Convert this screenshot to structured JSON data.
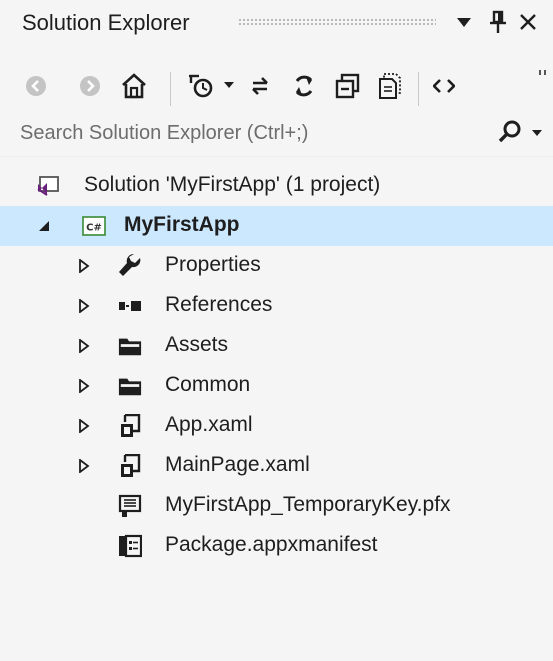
{
  "title_bar": {
    "title": "Solution Explorer",
    "icons": [
      "dropdown-arrow-icon",
      "pin-icon",
      "close-icon"
    ]
  },
  "toolbar": {
    "icons": [
      "back-icon",
      "forward-icon",
      "home-icon",
      "pending-changes-icon",
      "dropdown-arrow-icon",
      "sync-icon",
      "refresh-icon",
      "collapse-all-icon",
      "show-all-files-icon",
      "view-code-icon",
      "more-icon"
    ]
  },
  "search": {
    "placeholder": "Search Solution Explorer (Ctrl+;)",
    "icons": [
      "search-icon",
      "dropdown-arrow-icon"
    ]
  },
  "tree": {
    "solution": {
      "label": "Solution 'MyFirstApp' (1 project)",
      "icon": "solution-icon"
    },
    "project": {
      "label": "MyFirstApp",
      "icon": "csharp-project-icon",
      "expanded": true,
      "selected": true
    },
    "items": [
      {
        "label": "Properties",
        "icon": "wrench-icon",
        "expandable": true
      },
      {
        "label": "References",
        "icon": "references-icon",
        "expandable": true
      },
      {
        "label": "Assets",
        "icon": "folder-icon",
        "expandable": true
      },
      {
        "label": "Common",
        "icon": "folder-icon",
        "expandable": true
      },
      {
        "label": "App.xaml",
        "icon": "xaml-file-icon",
        "expandable": true
      },
      {
        "label": "MainPage.xaml",
        "icon": "xaml-file-icon",
        "expandable": true
      },
      {
        "label": "MyFirstApp_TemporaryKey.pfx",
        "icon": "certificate-icon",
        "expandable": false
      },
      {
        "label": "Package.appxmanifest",
        "icon": "manifest-icon",
        "expandable": false
      }
    ]
  },
  "colors": {
    "background": "#f5f5f5",
    "selection": "#cce8ff",
    "solution_icon": "#68217a",
    "csharp_icon": "#388a34",
    "text": "#1e1e1e",
    "muted": "#6d6d6d",
    "disabled": "#c4c4c4"
  }
}
